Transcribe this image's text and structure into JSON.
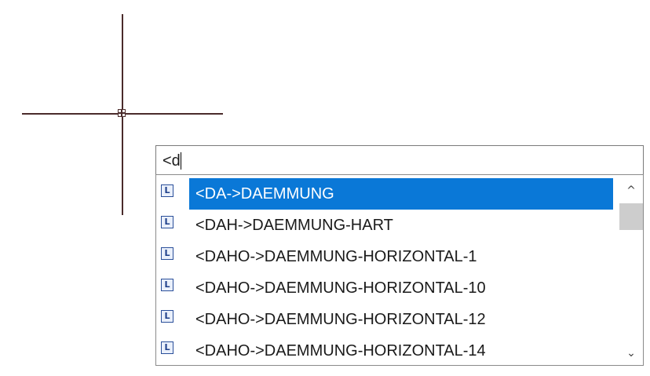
{
  "command_input": {
    "value": "<d"
  },
  "autocomplete": {
    "items": [
      {
        "label": "<DA->DAEMMUNG",
        "icon": "layer-icon",
        "icon_glyph": "L",
        "selected": true
      },
      {
        "label": "<DAH->DAEMMUNG-HART",
        "icon": "layer-icon",
        "icon_glyph": "L",
        "selected": false
      },
      {
        "label": "<DAHO->DAEMMUNG-HORIZONTAL-1",
        "icon": "layer-icon",
        "icon_glyph": "L",
        "selected": false
      },
      {
        "label": "<DAHO->DAEMMUNG-HORIZONTAL-10",
        "icon": "layer-icon",
        "icon_glyph": "L",
        "selected": false
      },
      {
        "label": "<DAHO->DAEMMUNG-HORIZONTAL-12",
        "icon": "layer-icon",
        "icon_glyph": "L",
        "selected": false
      },
      {
        "label": "<DAHO->DAEMMUNG-HORIZONTAL-14",
        "icon": "layer-icon",
        "icon_glyph": "L",
        "selected": false
      }
    ]
  },
  "scrollbar": {
    "up_glyph": "^",
    "down_glyph": "⌄"
  },
  "colors": {
    "selection": "#0a78d7",
    "crosshair": "#4a2b2b",
    "icon_border": "#2a4f9a"
  }
}
